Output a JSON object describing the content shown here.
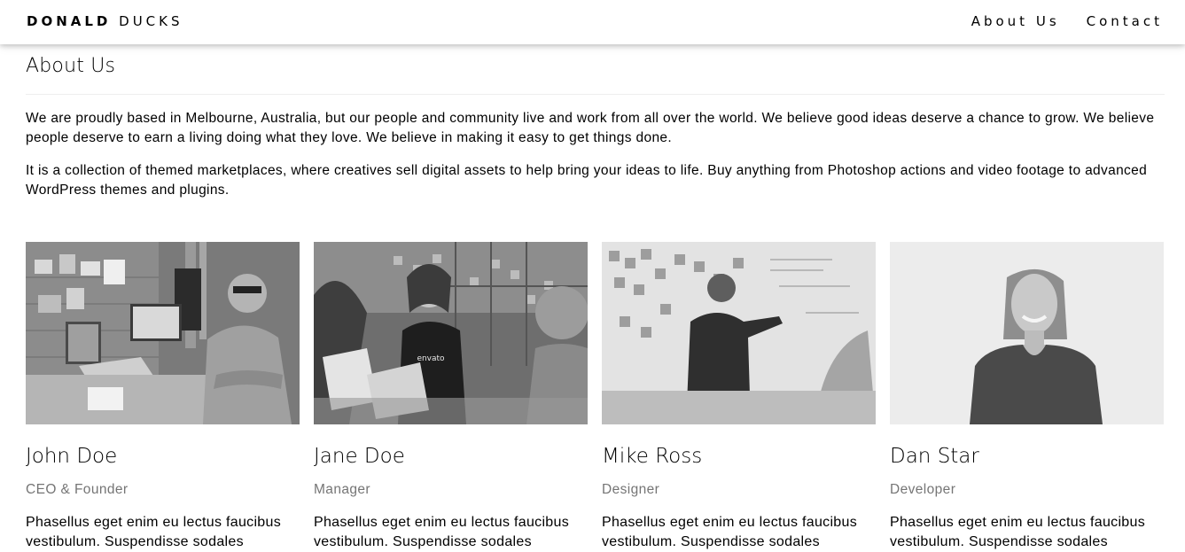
{
  "header": {
    "brand_bold": "DONALD",
    "brand_light": "DUCKS",
    "nav": [
      {
        "label": "About Us"
      },
      {
        "label": "Contact"
      }
    ]
  },
  "about": {
    "title": "About Us",
    "paragraphs": [
      "We are proudly based in Melbourne, Australia, but our people and community live and work from all over the world. We believe good ideas deserve a chance to grow. We believe people deserve to earn a living doing what they love. We believe in making it easy to get things done.",
      "It is a collection of themed marketplaces, where creatives sell digital assets to help bring your ideas to life. Buy anything from Photoshop actions and video footage to advanced WordPress themes and plugins."
    ]
  },
  "team": [
    {
      "name": "John Doe",
      "role": "CEO & Founder",
      "bio": "Phasellus eget enim eu lectus faucibus vestibulum. Suspendisse sodales",
      "photo_logo": ""
    },
    {
      "name": "Jane Doe",
      "role": "Manager",
      "bio": "Phasellus eget enim eu lectus faucibus vestibulum. Suspendisse sodales",
      "photo_logo": "envato"
    },
    {
      "name": "Mike Ross",
      "role": "Designer",
      "bio": "Phasellus eget enim eu lectus faucibus vestibulum. Suspendisse sodales",
      "photo_logo": ""
    },
    {
      "name": "Dan Star",
      "role": "Developer",
      "bio": "Phasellus eget enim eu lectus faucibus vestibulum. Suspendisse sodales",
      "photo_logo": ""
    }
  ]
}
